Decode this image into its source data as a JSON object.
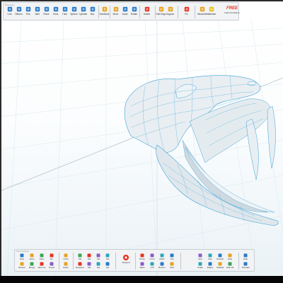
{
  "app": {
    "toolbar_title": "Primitives",
    "bottom_toolbar_title": "View Settings"
  },
  "top_toolbar": {
    "primitives": [
      {
        "label": "Line",
        "icon": "line-icon",
        "color": "#2a7ac8"
      },
      {
        "label": "Ribbon",
        "icon": "ribbon-icon",
        "color": "#2a7ac8"
      },
      {
        "label": "Tent",
        "icon": "tent-icon",
        "color": "#2a7ac8"
      },
      {
        "label": "Wall",
        "icon": "wall-icon",
        "color": "#2a7ac8"
      },
      {
        "label": "Plane",
        "icon": "plane-icon",
        "color": "#2a7ac8"
      },
      {
        "label": "Torus",
        "icon": "torus-icon",
        "color": "#2a7ac8"
      },
      {
        "label": "Tube",
        "icon": "tube-icon",
        "color": "#2a7ac8"
      },
      {
        "label": "Sphere",
        "icon": "sphere-icon",
        "color": "#2a7ac8"
      },
      {
        "label": "Cylinder",
        "icon": "cylinder-icon",
        "color": "#2a7ac8"
      },
      {
        "label": "Box",
        "icon": "box-icon",
        "color": "#2a7ac8"
      }
    ],
    "subdivide": {
      "label": "Subdivide",
      "icon": "subdivide-icon",
      "color": "#e8a21e"
    },
    "transform": [
      {
        "label": "Move",
        "icon": "move-icon",
        "color": "#e8a21e"
      },
      {
        "label": "Scale",
        "icon": "scale-icon",
        "color": "#2a7ac8"
      },
      {
        "label": "Rotate",
        "icon": "rotate-icon",
        "color": "#2a7ac8"
      }
    ],
    "delete": {
      "label": "Delete",
      "icon": "delete-icon",
      "color": "#e8321e"
    },
    "misc": [
      {
        "label": "Soft Edge",
        "icon": "soft-edge-icon",
        "color": "#e8a21e"
      },
      {
        "label": "Organic",
        "icon": "organic-icon",
        "color": "#e8a21e"
      }
    ],
    "fix": {
      "label": "Fix",
      "icon": "fix-icon",
      "color": "#e8321e"
    },
    "share": [
      {
        "label": "Weavefix",
        "icon": "weave-icon",
        "color": "#e8a21e"
      },
      {
        "label": "Materials",
        "icon": "materials-icon",
        "color": "#e8c21e"
      }
    ],
    "free": {
      "text": "FREE",
      "label": "Hide this Button"
    }
  },
  "bottom_toolbar": {
    "file": [
      [
        "New",
        "Open",
        "Save",
        "Ex"
      ],
      [
        "Recent",
        "Merge",
        "Save As",
        "Import"
      ]
    ],
    "undo": {
      "top": "Undo",
      "bottom": "Redo"
    },
    "select": [
      [
        "Sel",
        "Sel",
        "Sel",
        "Sel"
      ],
      [
        "Deselect",
        "Sel",
        "Sel",
        "Sel"
      ]
    ],
    "viewport": {
      "label": "Viewport"
    },
    "views": [
      [
        "Persp",
        "Front",
        "Right",
        "Top"
      ],
      [
        "Back",
        "Left",
        "Bottom",
        "Pick"
      ]
    ],
    "display": [
      [
        "Grid",
        "Flat",
        "Smooth",
        "Hide"
      ],
      [
        "Scale",
        "Edges",
        "Shaded",
        "Hide All"
      ]
    ],
    "help": {
      "top": "Help",
      "bottom": "Tutorials"
    }
  }
}
